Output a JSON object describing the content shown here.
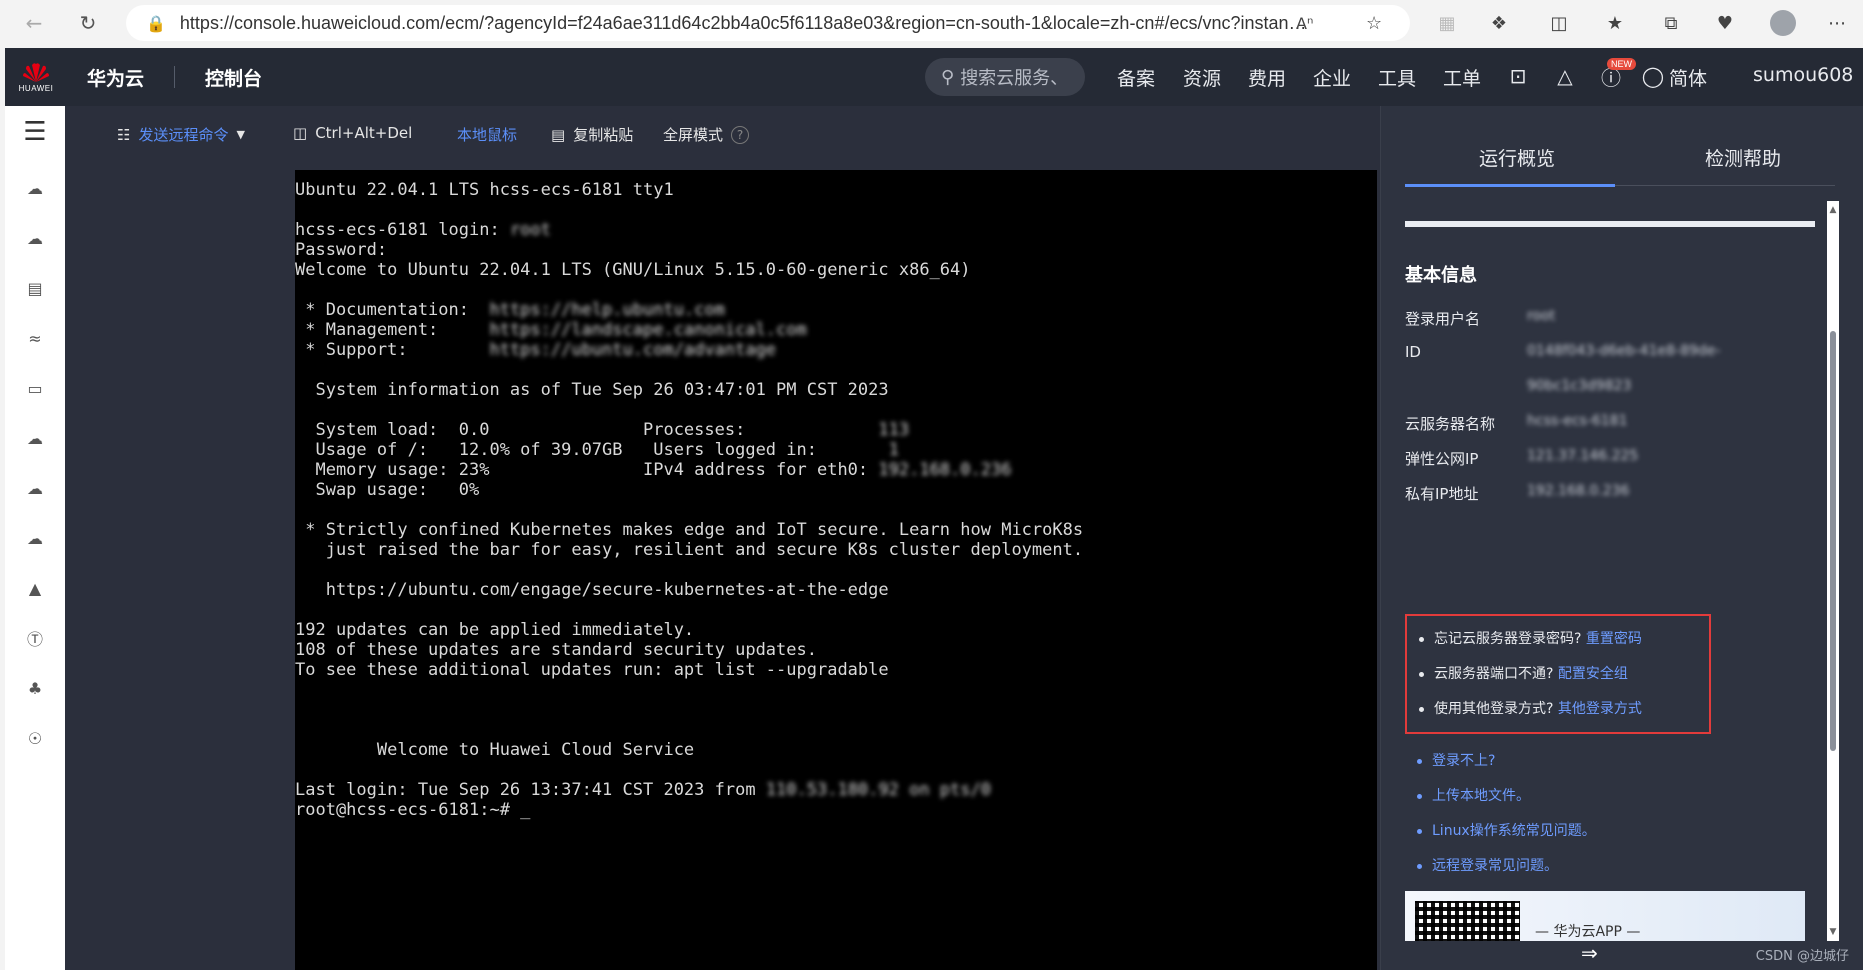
{
  "browser": {
    "url": "https://console.huaweicloud.com/ecm/?agencyId=f24a6ae311d64c2bb4a0c5f6118a8e03&region=cn-south-1&locale=zh-cn#/ecs/vnc?instance..."
  },
  "header": {
    "logo_word": "HUAWEI",
    "brand": "华为云",
    "console": "控制台",
    "search_placeholder": "搜索云服务、",
    "nav": [
      "备案",
      "资源",
      "费用",
      "企业",
      "工具",
      "工单"
    ],
    "new_badge": "NEW",
    "language": "简体",
    "username": "sumou608"
  },
  "toolbar": {
    "send_command": "发送远程命令",
    "ctrl_alt_del": "Ctrl+Alt+Del",
    "local_mouse": "本地鼠标",
    "copy_paste": "复制粘贴",
    "fullscreen": "全屏模式"
  },
  "terminal": {
    "lines": [
      "Ubuntu 22.04.1 LTS hcss-ecs-6181 tty1",
      "",
      "hcss-ecs-6181 login: ",
      "Password:",
      "Welcome to Ubuntu 22.04.1 LTS (GNU/Linux 5.15.0-60-generic x86_64)",
      "",
      " * Documentation:  ",
      " * Management:     ",
      " * Support:        ",
      "",
      "  System information as of Tue Sep 26 03:47:01 PM CST 2023",
      "",
      "  System load:  0.0               Processes:             ",
      "  Usage of /:   12.0% of 39.07GB   Users logged in:       ",
      "  Memory usage: 23%               IPv4 address for eth0: ",
      "  Swap usage:   0%",
      "",
      " * Strictly confined Kubernetes makes edge and IoT secure. Learn how MicroK8s",
      "   just raised the bar for easy, resilient and secure K8s cluster deployment.",
      "",
      "   https://ubuntu.com/engage/secure-kubernetes-at-the-edge",
      "",
      "192 updates can be applied immediately.",
      "108 of these updates are standard security updates.",
      "To see these additional updates run: apt list --upgradable",
      "",
      "",
      "",
      "        Welcome to Huawei Cloud Service",
      "",
      "Last login: Tue Sep 26 13:37:41 CST 2023 from ",
      "root@hcss-ecs-6181:~# _"
    ],
    "blurred": {
      "2": "root",
      "6": "https://help.ubuntu.com",
      "7": "https://landscape.canonical.com",
      "8": "https://ubuntu.com/advantage",
      "12": "113",
      "13": "1",
      "14": "192.168.0.236",
      "30": "110.53.180.92 on pts/0"
    }
  },
  "panel": {
    "tab_overview": "运行概览",
    "tab_help": "检测帮助",
    "section_title": "基本信息",
    "fields": [
      {
        "label": "登录用户名",
        "value": "root"
      },
      {
        "label": "ID",
        "value": "0148f043-d6eb-41e8-89de-"
      },
      {
        "label": "",
        "value": "90bc1c3d9823"
      },
      {
        "label": "云服务器名称",
        "value": "hcss-ecs-6181"
      },
      {
        "label": "弹性公网IP",
        "value": "121.37.146.225"
      },
      {
        "label": "私有IP地址",
        "value": "192.168.0.236"
      }
    ],
    "help": [
      {
        "text": "忘记云服务器登录密码?",
        "link": "重置密码"
      },
      {
        "text": "云服务器端口不通?",
        "link": "配置安全组"
      },
      {
        "text": "使用其他登录方式?",
        "link": "其他登录方式"
      }
    ],
    "extra_links": [
      "登录不上?",
      "上传本地文件。",
      "Linux操作系统常见问题。",
      "远程登录常见问题。"
    ],
    "app_promo": "— 华为云APP —"
  },
  "watermark": "CSDN @边城仔"
}
